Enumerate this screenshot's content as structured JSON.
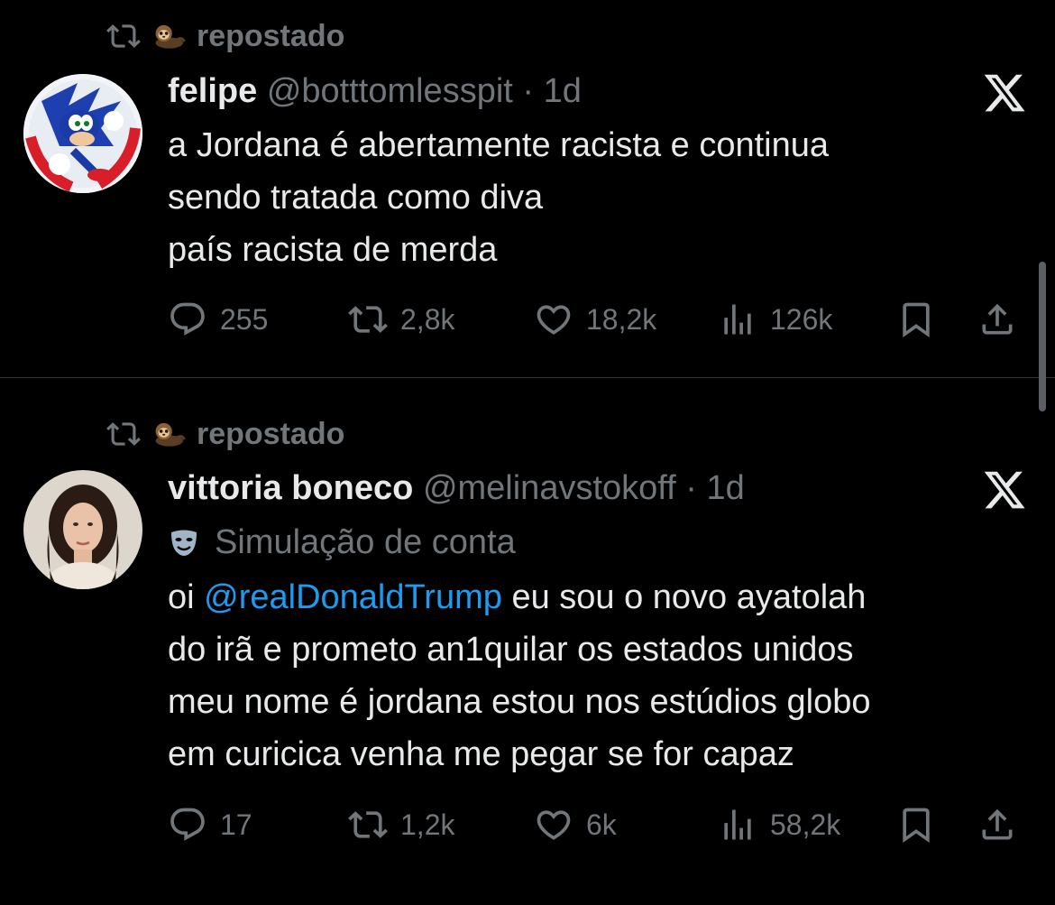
{
  "tweets": [
    {
      "repost_label": "repostado",
      "name": "felipe",
      "handle": "@botttomlesspit",
      "time": "· 1d",
      "lines": [
        "a Jordana é abertamente racista e continua",
        "sendo tratada como diva",
        "país racista de merda"
      ],
      "stats": {
        "replies": "255",
        "reposts": "2,8k",
        "likes": "18,2k",
        "views": "126k"
      }
    },
    {
      "repost_label": "repostado",
      "name": "vittoria boneco",
      "handle": "@melinavstokoff",
      "time": "· 1d",
      "account_label": "Simulação de conta",
      "line1_prefix": "oi ",
      "mention": "@realDonaldTrump",
      "line1_suffix": " eu sou o novo ayatolah",
      "lines": [
        "do irã e prometo an1quilar os estados unidos",
        "meu nome é jordana estou nos estúdios globo",
        "em curicica venha me pegar se for capaz"
      ],
      "stats": {
        "replies": "17",
        "reposts": "1,2k",
        "likes": "6k",
        "views": "58,2k"
      }
    }
  ],
  "icons": [
    "repost-icon",
    "sloth-emoji",
    "x-logo-icon",
    "reply-icon",
    "like-icon",
    "views-icon",
    "bookmark-icon",
    "share-icon",
    "theater-mask-icon"
  ],
  "colors": {
    "background": "#000000",
    "text": "#e7e9ea",
    "muted": "#71767b",
    "link": "#1d9bf0",
    "divider": "#2f3336"
  }
}
